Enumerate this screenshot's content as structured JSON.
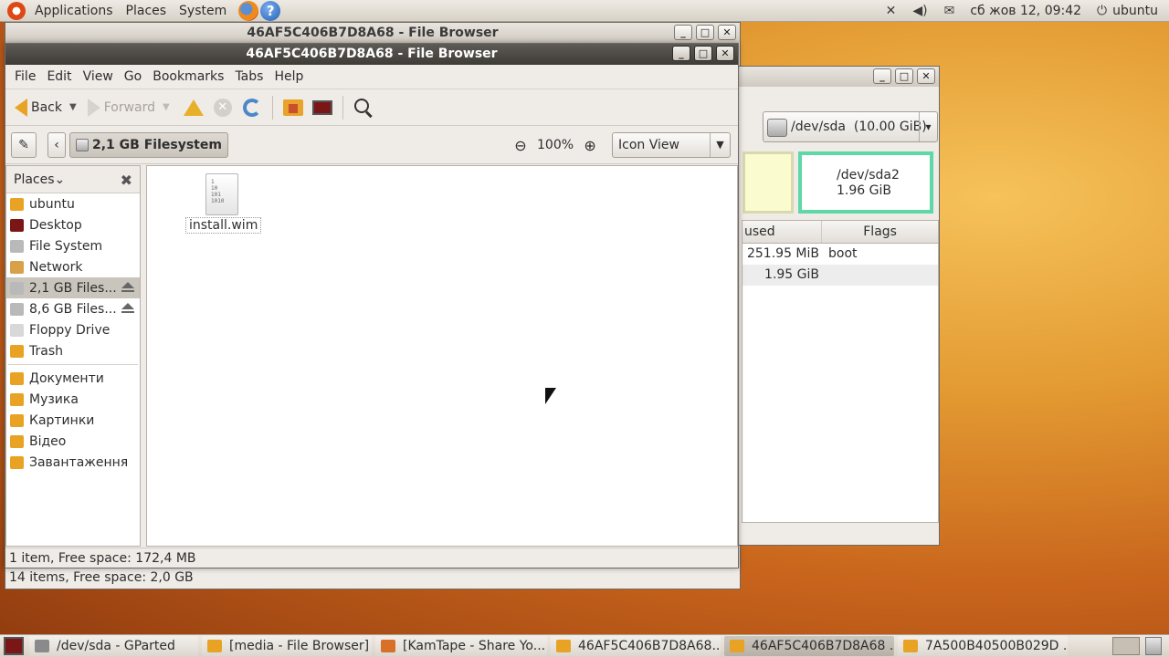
{
  "top_panel": {
    "applications": "Applications",
    "places": "Places",
    "system": "System",
    "clock": "сб жов 12, 09:42",
    "user": "ubuntu"
  },
  "back_window": {
    "title": "46AF5C406B7D8A68 - File Browser",
    "status": "14 items, Free space: 2,0 GB"
  },
  "gparted": {
    "device": "/dev/sda  (10.00 GiB)",
    "part2_name": "/dev/sda2",
    "part2_size": "1.96 GiB",
    "col_used": "used",
    "col_flags": "Flags",
    "rows": [
      {
        "used": "251.95 MiB",
        "flags": "boot"
      },
      {
        "used": "1.95 GiB",
        "flags": ""
      }
    ]
  },
  "window": {
    "title": "46AF5C406B7D8A68 - File Browser",
    "menu": {
      "file": "File",
      "edit": "Edit",
      "view": "View",
      "go": "Go",
      "bookmarks": "Bookmarks",
      "tabs": "Tabs",
      "help": "Help"
    },
    "toolbar": {
      "back": "Back",
      "forward": "Forward"
    },
    "location": {
      "crumb": "2,1 GB Filesystem",
      "zoom": "100%",
      "view_mode": "Icon View"
    },
    "sidebar": {
      "header": "Places",
      "places": [
        {
          "label": "ubuntu",
          "color": "#e8a325"
        },
        {
          "label": "Desktop",
          "color": "#7a1616"
        },
        {
          "label": "File System",
          "color": "#b9b9b9"
        },
        {
          "label": "Network",
          "color": "#d9a04a"
        },
        {
          "label": "2,1 GB Files...",
          "color": "#b9b9b9"
        },
        {
          "label": "8,6 GB Files...",
          "color": "#b9b9b9"
        },
        {
          "label": "Floppy Drive",
          "color": "#d8d8d8"
        },
        {
          "label": "Trash",
          "color": "#e8a325"
        }
      ],
      "bookmarks": [
        {
          "label": "Документи",
          "color": "#e8a325"
        },
        {
          "label": "Музика",
          "color": "#e8a325"
        },
        {
          "label": "Картинки",
          "color": "#e8a325"
        },
        {
          "label": "Відео",
          "color": "#e8a325"
        },
        {
          "label": "Завантаження",
          "color": "#e8a325"
        }
      ]
    },
    "file": {
      "name": "install.wim",
      "icon_text": "1\n10\n101\n1010"
    },
    "status": "1 item, Free space: 172,4 MB"
  },
  "taskbar": [
    {
      "label": "/dev/sda - GParted",
      "active": false,
      "color": "#8a8a8a"
    },
    {
      "label": "[media - File Browser]",
      "active": false,
      "color": "#e8a325"
    },
    {
      "label": "[KamTape - Share Yo...",
      "active": false,
      "color": "#d9702a"
    },
    {
      "label": "46AF5C406B7D8A68...",
      "active": false,
      "color": "#e8a325"
    },
    {
      "label": "46AF5C406B7D8A68 ...",
      "active": true,
      "color": "#e8a325"
    },
    {
      "label": "7A500B40500B029D ...",
      "active": false,
      "color": "#e8a325"
    }
  ]
}
